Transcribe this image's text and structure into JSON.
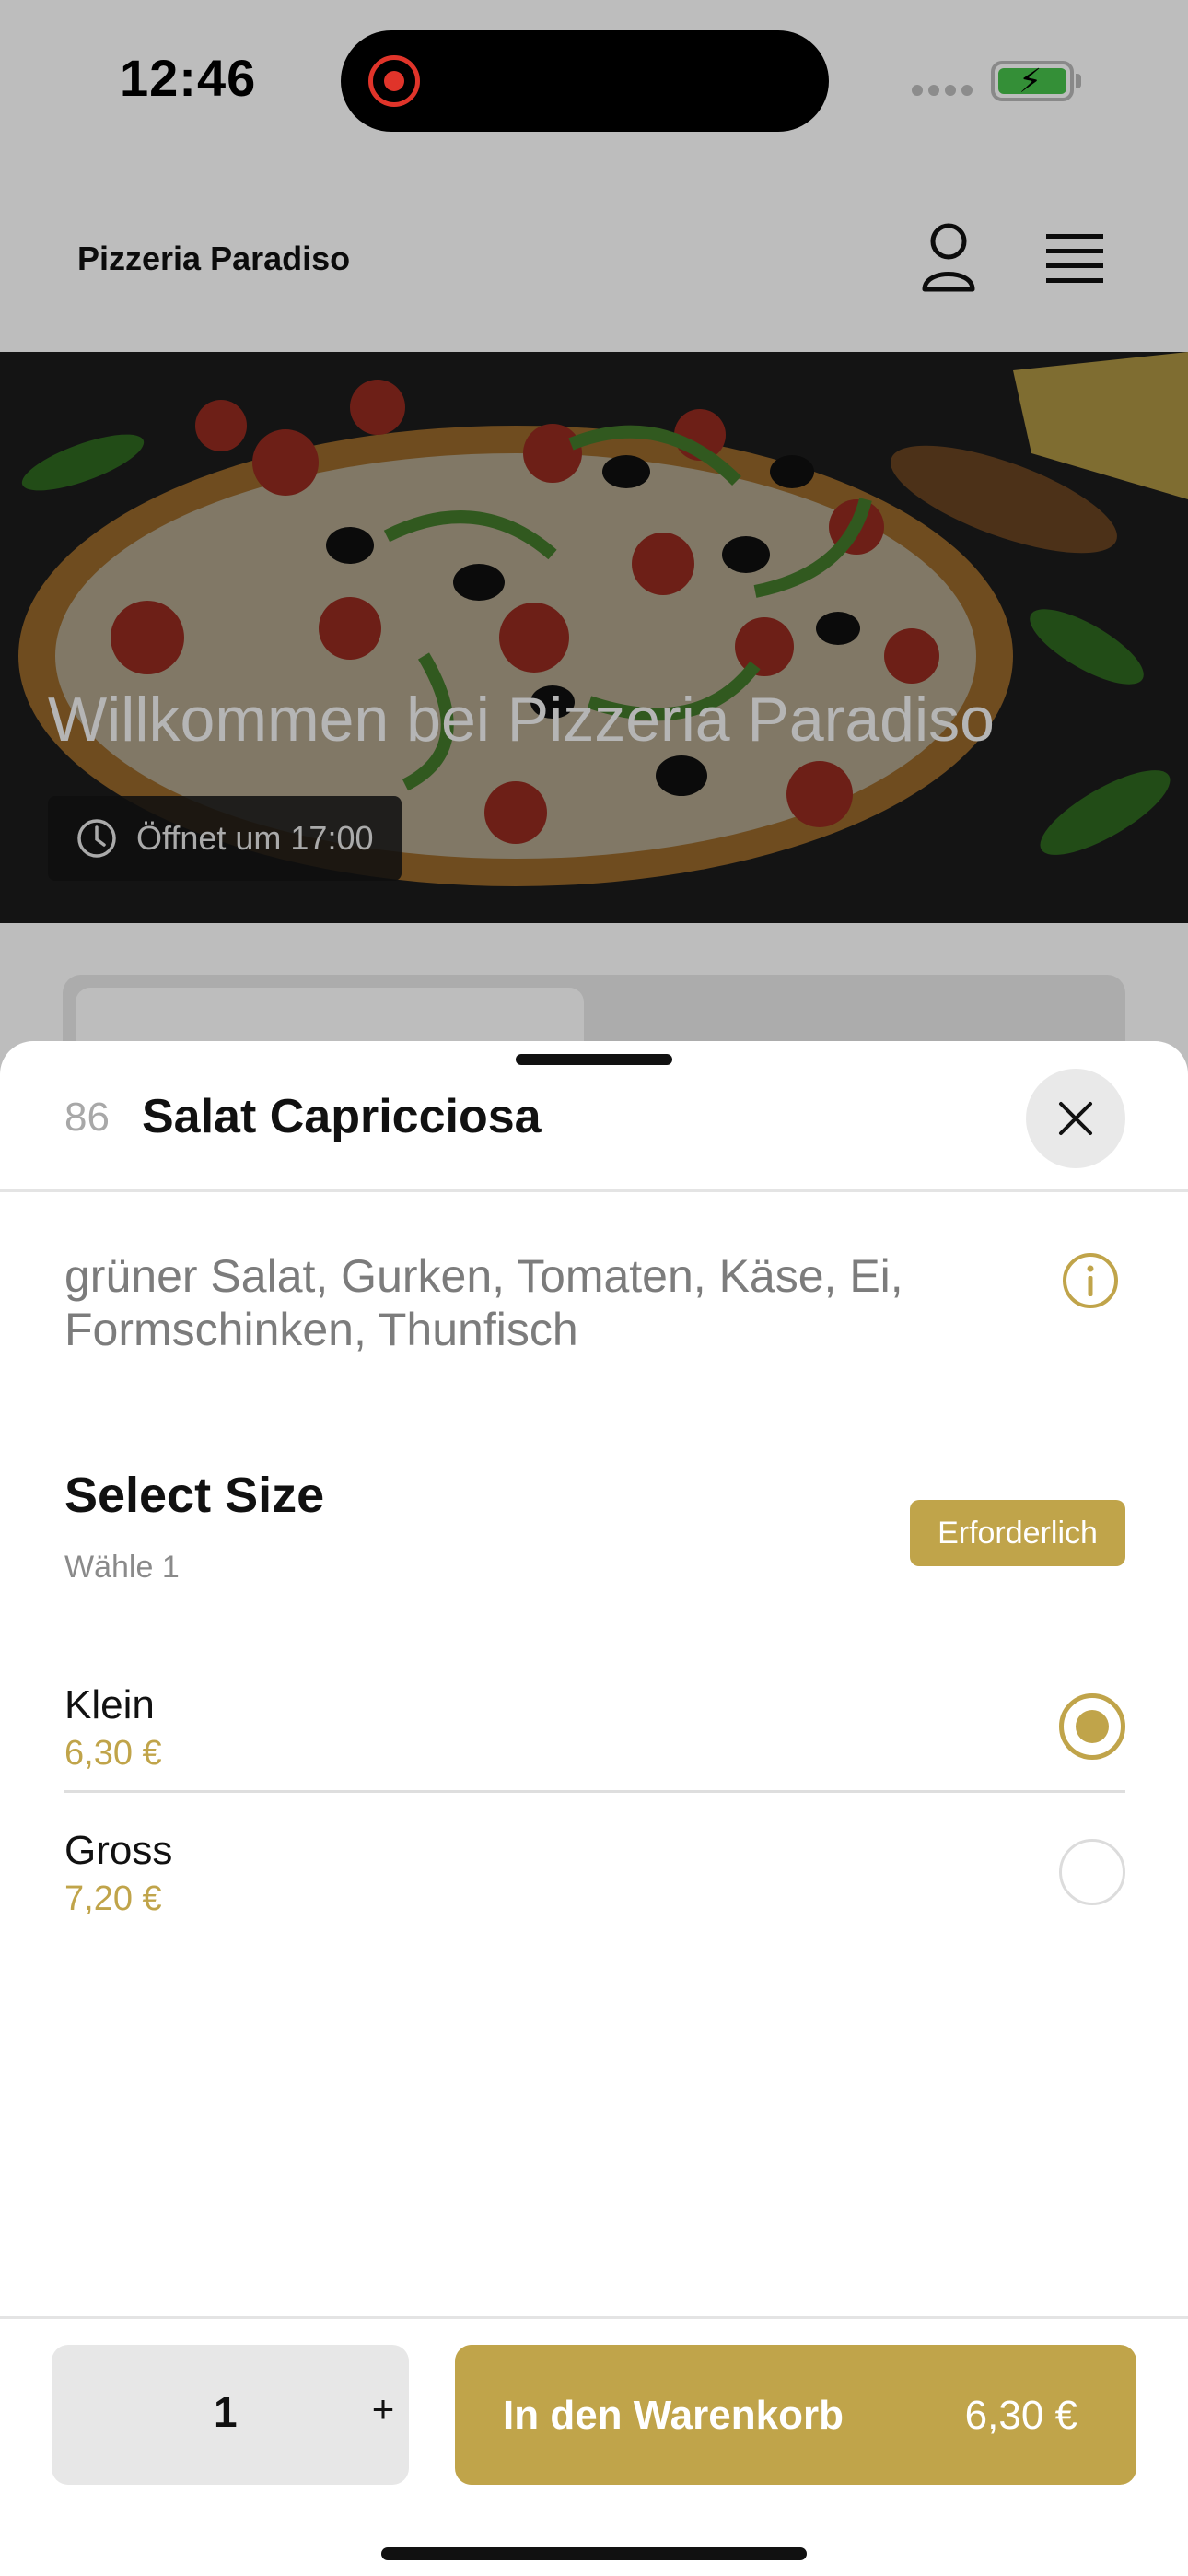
{
  "status_bar": {
    "time": "12:46"
  },
  "header": {
    "brand": "Pizzeria Paradiso"
  },
  "hero": {
    "title": "Willkommen bei Pizzeria Paradiso",
    "hours": "Öffnet um 17:00"
  },
  "sheet": {
    "item_number": "86",
    "item_title": "Salat Capricciosa",
    "description": "grüner Salat, Gurken, Tomaten, Käse, Ei, Formschinken, Thunfisch",
    "size_section": {
      "title": "Select Size",
      "subtitle": "Wähle 1",
      "required_badge": "Erforderlich",
      "options": [
        {
          "name": "Klein",
          "price": "6,30 €",
          "selected": true
        },
        {
          "name": "Gross",
          "price": "7,20 €",
          "selected": false
        }
      ]
    },
    "footer": {
      "quantity": "1",
      "plus_label": "+",
      "add_to_cart_label": "In den Warenkorb",
      "total_price": "6,30 €"
    }
  },
  "colors": {
    "accent": "#c0a44a",
    "overlay": "rgba(0,0,0,0.26)"
  },
  "icons": [
    "record-icon",
    "battery-icon",
    "user-icon",
    "menu-icon",
    "clock-icon",
    "close-icon",
    "info-icon"
  ]
}
